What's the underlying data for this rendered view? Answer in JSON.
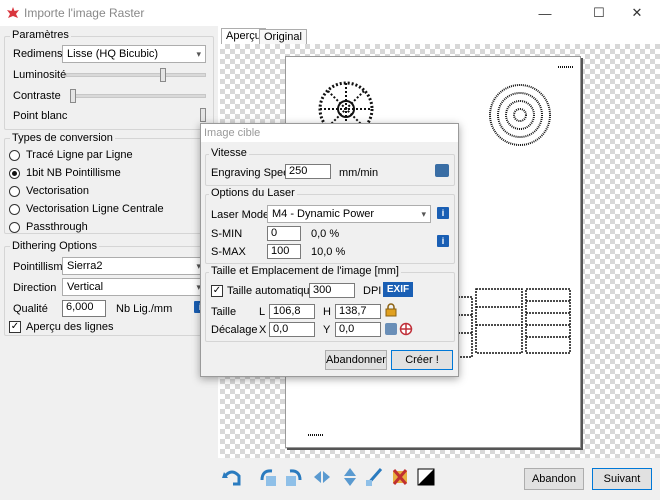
{
  "window": {
    "title": "Importe l'image Raster",
    "minimize": "—",
    "maximize": "☐",
    "close": "✕"
  },
  "params": {
    "title": "Paramètres",
    "resize_label": "Redimens.",
    "resize_value": "Lisse (HQ Bicubic)",
    "brightness_label": "Luminosité",
    "contrast_label": "Contraste",
    "white_point_label": "Point blanc",
    "brightness_level": 0.7,
    "contrast_level": 0.0,
    "white_point_level": 1.0
  },
  "conversion": {
    "title": "Types de conversion",
    "options": [
      "Tracé Ligne par Ligne",
      "1bit NB Pointillisme",
      "Vectorisation",
      "Vectorisation Ligne Centrale",
      "Passthrough"
    ],
    "selected": 1
  },
  "dithering": {
    "title": "Dithering Options",
    "mode_label": "Pointillisme",
    "mode_value": "Sierra2",
    "direction_label": "Direction",
    "direction_value": "Vertical",
    "quality_label": "Qualité",
    "quality_value": "6,000",
    "quality_unit": "Nb Lig./mm",
    "preview_lines_label": "Aperçu des lignes",
    "preview_lines_checked": true
  },
  "tabs": [
    "Aperçu",
    "Original"
  ],
  "dialog": {
    "title": "Image cible",
    "speed_section": "Vitesse",
    "engraving_label": "Engraving Speed",
    "engraving_value": "250",
    "engraving_unit": "mm/min",
    "laser_section": "Options du Laser",
    "laser_mode_label": "Laser Mode",
    "laser_mode_value": "M4 - Dynamic Power",
    "smin_label": "S-MIN",
    "smin_value": "0",
    "smin_pct": "0,0 %",
    "smax_label": "S-MAX",
    "smax_value": "100",
    "smax_pct": "10,0 %",
    "size_section": "Taille et Emplacement de l'image [mm]",
    "auto_size_label": "Taille automatique",
    "dpi_value": "300",
    "dpi_label": "DPI",
    "exif_label": "EXIF",
    "size_label": "Taille",
    "l_label": "L",
    "l_value": "106,8",
    "h_label": "H",
    "h_value": "138,7",
    "offset_label": "Décalage",
    "x_label": "X",
    "x_value": "0,0",
    "y_label": "Y",
    "y_value": "0,0",
    "cancel_label": "Abandonner",
    "create_label": "Créer !",
    "info": "i"
  },
  "footer": {
    "abandon_label": "Abandon",
    "next_label": "Suivant"
  }
}
